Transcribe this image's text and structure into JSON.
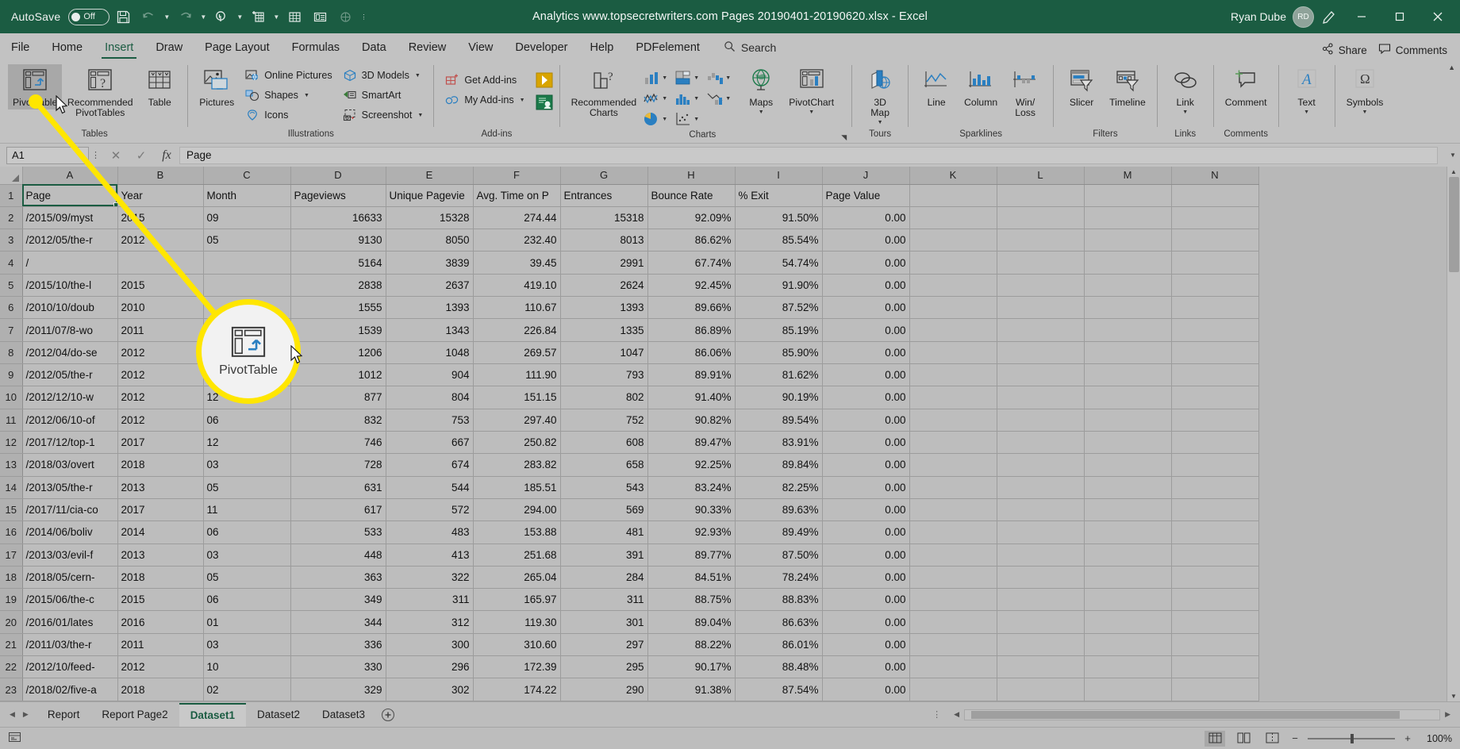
{
  "titlebar": {
    "autosave_label": "AutoSave",
    "autosave_state": "Off",
    "document_title": "Analytics www.topsecretwriters.com Pages 20190401-20190620.xlsx  -  Excel",
    "user_name": "Ryan Dube",
    "avatar_initials": "RD",
    "qat_icons": [
      "save-icon",
      "undo-icon",
      "redo-icon",
      "touch-mode-icon",
      "new-icon",
      "grid-icon",
      "form-icon",
      "print-preview-icon",
      "more-icon"
    ],
    "window_buttons": [
      "minimize",
      "restore",
      "close"
    ]
  },
  "tabs": {
    "items": [
      {
        "label": "File",
        "active": false
      },
      {
        "label": "Home",
        "active": false
      },
      {
        "label": "Insert",
        "active": true
      },
      {
        "label": "Draw",
        "active": false
      },
      {
        "label": "Page Layout",
        "active": false
      },
      {
        "label": "Formulas",
        "active": false
      },
      {
        "label": "Data",
        "active": false
      },
      {
        "label": "Review",
        "active": false
      },
      {
        "label": "View",
        "active": false
      },
      {
        "label": "Developer",
        "active": false
      },
      {
        "label": "Help",
        "active": false
      },
      {
        "label": "PDFelement",
        "active": false
      }
    ],
    "search_label": "Search",
    "share_label": "Share",
    "comments_label": "Comments"
  },
  "ribbon": {
    "groups": [
      {
        "name": "Tables",
        "label": "Tables",
        "big_buttons": [
          {
            "label": "PivotTable",
            "icon": "pivottable-icon",
            "selected": true
          },
          {
            "label": "Recommended\nPivotTables",
            "icon": "recommended-pivottables-icon",
            "selected": false
          },
          {
            "label": "Table",
            "icon": "table-icon",
            "selected": false
          }
        ]
      },
      {
        "name": "Illustrations",
        "label": "Illustrations",
        "big_buttons": [
          {
            "label": "Pictures",
            "icon": "pictures-icon",
            "selected": false
          }
        ],
        "small_buttons": [
          {
            "label": "Online Pictures",
            "icon": "online-pictures-icon",
            "caret": false
          },
          {
            "label": "Shapes",
            "icon": "shapes-icon",
            "caret": true
          },
          {
            "label": "Icons",
            "icon": "icons-icon",
            "caret": false
          },
          {
            "label": "3D Models",
            "icon": "3d-models-icon",
            "caret": true
          },
          {
            "label": "SmartArt",
            "icon": "smartart-icon",
            "caret": false
          },
          {
            "label": "Screenshot",
            "icon": "screenshot-icon",
            "caret": true
          }
        ]
      },
      {
        "name": "Add-ins",
        "label": "Add-ins",
        "small_buttons": [
          {
            "label": "Get Add-ins",
            "icon": "get-addins-icon",
            "caret": false
          },
          {
            "label": "My Add-ins",
            "icon": "my-addins-icon",
            "caret": true
          }
        ],
        "tiles": [
          "bing-maps-addin-icon",
          "people-graph-addin-icon"
        ]
      },
      {
        "name": "Charts",
        "label": "Charts",
        "big_buttons": [
          {
            "label": "Recommended\nCharts",
            "icon": "recommended-charts-icon",
            "selected": false
          },
          {
            "label": "Maps",
            "icon": "maps-icon",
            "selected": false,
            "caret": true
          },
          {
            "label": "PivotChart",
            "icon": "pivotchart-icon",
            "selected": false,
            "caret": true
          }
        ],
        "chart_grid": [
          "column-chart-icon",
          "hierarchy-chart-icon",
          "waterfall-chart-icon",
          "line-chart-icon",
          "statistic-chart-icon",
          "combo-chart-icon",
          "pie-chart-icon",
          "scatter-chart-icon"
        ]
      },
      {
        "name": "Tours",
        "label": "Tours",
        "big_buttons": [
          {
            "label": "3D\nMap",
            "icon": "3d-map-icon",
            "selected": false,
            "caret": true
          }
        ]
      },
      {
        "name": "Sparklines",
        "label": "Sparklines",
        "big_buttons": [
          {
            "label": "Line",
            "icon": "sparkline-line-icon",
            "selected": false
          },
          {
            "label": "Column",
            "icon": "sparkline-column-icon",
            "selected": false
          },
          {
            "label": "Win/\nLoss",
            "icon": "sparkline-winloss-icon",
            "selected": false
          }
        ]
      },
      {
        "name": "Filters",
        "label": "Filters",
        "big_buttons": [
          {
            "label": "Slicer",
            "icon": "slicer-icon",
            "selected": false
          },
          {
            "label": "Timeline",
            "icon": "timeline-icon",
            "selected": false
          }
        ]
      },
      {
        "name": "Links",
        "label": "Links",
        "big_buttons": [
          {
            "label": "Link",
            "icon": "link-icon",
            "selected": false,
            "caret": true
          }
        ]
      },
      {
        "name": "Comments",
        "label": "Comments",
        "big_buttons": [
          {
            "label": "Comment",
            "icon": "comment-icon",
            "selected": false
          }
        ]
      },
      {
        "name": "Text",
        "label": "",
        "big_buttons": [
          {
            "label": "Text",
            "icon": "text-icon",
            "selected": false,
            "caret": true
          }
        ]
      },
      {
        "name": "Symbols",
        "label": "",
        "big_buttons": [
          {
            "label": "Symbols",
            "icon": "symbols-icon",
            "selected": false,
            "caret": true
          }
        ]
      }
    ]
  },
  "formula_bar": {
    "name_box": "A1",
    "cancel_icon": "cancel-icon",
    "enter_icon": "confirm-icon",
    "function_icon": "insert-function-icon",
    "content": "Page"
  },
  "grid": {
    "columns": [
      "A",
      "B",
      "C",
      "D",
      "E",
      "F",
      "G",
      "H",
      "I",
      "J",
      "K",
      "L",
      "M",
      "N"
    ],
    "selected_cell": "A1",
    "rows": [
      {
        "n": "1",
        "cells": [
          "Page",
          "Year",
          "Month",
          "Pageviews",
          "Unique Pagevie",
          "Avg. Time on P",
          "Entrances",
          "Bounce Rate",
          "% Exit",
          "Page Value",
          "",
          "",
          "",
          ""
        ]
      },
      {
        "n": "2",
        "cells": [
          "/2015/09/myst",
          "2015",
          "09",
          "16633",
          "15328",
          "274.44",
          "15318",
          "92.09%",
          "91.50%",
          "0.00",
          "",
          "",
          "",
          ""
        ]
      },
      {
        "n": "3",
        "cells": [
          "/2012/05/the-r",
          "2012",
          "05",
          "9130",
          "8050",
          "232.40",
          "8013",
          "86.62%",
          "85.54%",
          "0.00",
          "",
          "",
          "",
          ""
        ]
      },
      {
        "n": "4",
        "cells": [
          "/",
          "",
          "",
          "5164",
          "3839",
          "39.45",
          "2991",
          "67.74%",
          "54.74%",
          "0.00",
          "",
          "",
          "",
          ""
        ]
      },
      {
        "n": "5",
        "cells": [
          "/2015/10/the-l",
          "2015",
          "",
          "2838",
          "2637",
          "419.10",
          "2624",
          "92.45%",
          "91.90%",
          "0.00",
          "",
          "",
          "",
          ""
        ]
      },
      {
        "n": "6",
        "cells": [
          "/2010/10/doub",
          "2010",
          "",
          "1555",
          "1393",
          "110.67",
          "1393",
          "89.66%",
          "87.52%",
          "0.00",
          "",
          "",
          "",
          ""
        ]
      },
      {
        "n": "7",
        "cells": [
          "/2011/07/8-wo",
          "2011",
          "",
          "1539",
          "1343",
          "226.84",
          "1335",
          "86.89%",
          "85.19%",
          "0.00",
          "",
          "",
          "",
          ""
        ]
      },
      {
        "n": "8",
        "cells": [
          "/2012/04/do-se",
          "2012",
          "",
          "1206",
          "1048",
          "269.57",
          "1047",
          "86.06%",
          "85.90%",
          "0.00",
          "",
          "",
          "",
          ""
        ]
      },
      {
        "n": "9",
        "cells": [
          "/2012/05/the-r",
          "2012",
          "",
          "1012",
          "904",
          "111.90",
          "793",
          "89.91%",
          "81.62%",
          "0.00",
          "",
          "",
          "",
          ""
        ]
      },
      {
        "n": "10",
        "cells": [
          "/2012/12/10-w",
          "2012",
          "12",
          "877",
          "804",
          "151.15",
          "802",
          "91.40%",
          "90.19%",
          "0.00",
          "",
          "",
          "",
          ""
        ]
      },
      {
        "n": "11",
        "cells": [
          "/2012/06/10-of",
          "2012",
          "06",
          "832",
          "753",
          "297.40",
          "752",
          "90.82%",
          "89.54%",
          "0.00",
          "",
          "",
          "",
          ""
        ]
      },
      {
        "n": "12",
        "cells": [
          "/2017/12/top-1",
          "2017",
          "12",
          "746",
          "667",
          "250.82",
          "608",
          "89.47%",
          "83.91%",
          "0.00",
          "",
          "",
          "",
          ""
        ]
      },
      {
        "n": "13",
        "cells": [
          "/2018/03/overt",
          "2018",
          "03",
          "728",
          "674",
          "283.82",
          "658",
          "92.25%",
          "89.84%",
          "0.00",
          "",
          "",
          "",
          ""
        ]
      },
      {
        "n": "14",
        "cells": [
          "/2013/05/the-r",
          "2013",
          "05",
          "631",
          "544",
          "185.51",
          "543",
          "83.24%",
          "82.25%",
          "0.00",
          "",
          "",
          "",
          ""
        ]
      },
      {
        "n": "15",
        "cells": [
          "/2017/11/cia-co",
          "2017",
          "11",
          "617",
          "572",
          "294.00",
          "569",
          "90.33%",
          "89.63%",
          "0.00",
          "",
          "",
          "",
          ""
        ]
      },
      {
        "n": "16",
        "cells": [
          "/2014/06/boliv",
          "2014",
          "06",
          "533",
          "483",
          "153.88",
          "481",
          "92.93%",
          "89.49%",
          "0.00",
          "",
          "",
          "",
          ""
        ]
      },
      {
        "n": "17",
        "cells": [
          "/2013/03/evil-f",
          "2013",
          "03",
          "448",
          "413",
          "251.68",
          "391",
          "89.77%",
          "87.50%",
          "0.00",
          "",
          "",
          "",
          ""
        ]
      },
      {
        "n": "18",
        "cells": [
          "/2018/05/cern-",
          "2018",
          "05",
          "363",
          "322",
          "265.04",
          "284",
          "84.51%",
          "78.24%",
          "0.00",
          "",
          "",
          "",
          ""
        ]
      },
      {
        "n": "19",
        "cells": [
          "/2015/06/the-c",
          "2015",
          "06",
          "349",
          "311",
          "165.97",
          "311",
          "88.75%",
          "88.83%",
          "0.00",
          "",
          "",
          "",
          ""
        ]
      },
      {
        "n": "20",
        "cells": [
          "/2016/01/lates",
          "2016",
          "01",
          "344",
          "312",
          "119.30",
          "301",
          "89.04%",
          "86.63%",
          "0.00",
          "",
          "",
          "",
          ""
        ]
      },
      {
        "n": "21",
        "cells": [
          "/2011/03/the-r",
          "2011",
          "03",
          "336",
          "300",
          "310.60",
          "297",
          "88.22%",
          "86.01%",
          "0.00",
          "",
          "",
          "",
          ""
        ]
      },
      {
        "n": "22",
        "cells": [
          "/2012/10/feed-",
          "2012",
          "10",
          "330",
          "296",
          "172.39",
          "295",
          "90.17%",
          "88.48%",
          "0.00",
          "",
          "",
          "",
          ""
        ]
      },
      {
        "n": "23",
        "cells": [
          "/2018/02/five-a",
          "2018",
          "02",
          "329",
          "302",
          "174.22",
          "290",
          "91.38%",
          "87.54%",
          "0.00",
          "",
          "",
          "",
          ""
        ]
      }
    ]
  },
  "sheet_tabs": {
    "items": [
      {
        "label": "Report",
        "active": false
      },
      {
        "label": "Report Page2",
        "active": false
      },
      {
        "label": "Dataset1",
        "active": true
      },
      {
        "label": "Dataset2",
        "active": false
      },
      {
        "label": "Dataset3",
        "active": false
      }
    ],
    "add_label": "+"
  },
  "status_bar": {
    "ready_text": "",
    "views": [
      "normal-view-icon",
      "page-layout-view-icon",
      "page-break-view-icon"
    ],
    "zoom_value": "100%",
    "zoom_out": "−",
    "zoom_in": "+"
  },
  "annotation": {
    "callout_label": "PivotTable",
    "highlight_color": "#ffe600",
    "pointer_icon": "mouse-cursor-icon"
  }
}
